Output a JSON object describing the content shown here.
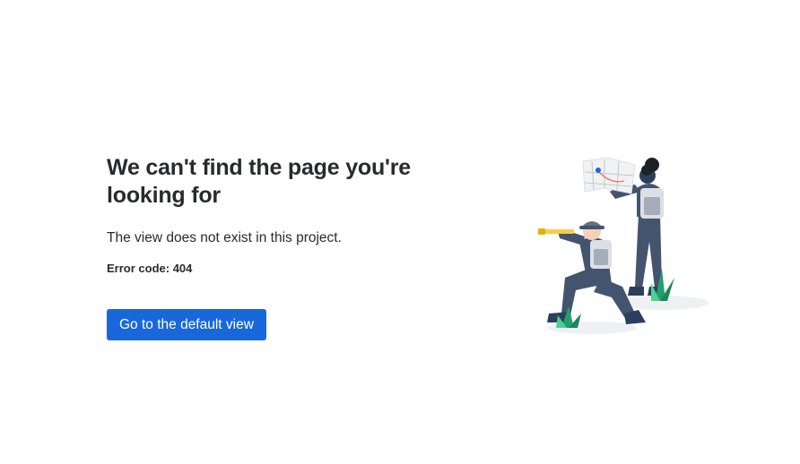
{
  "error_page": {
    "title": "We can't find the page you're looking for",
    "description": "The view does not exist in this project.",
    "error_code_label": "Error code:",
    "error_code_value": "404",
    "button_label": "Go to the default view"
  },
  "colors": {
    "primary_button": "#1868db",
    "text": "#292a2e",
    "figure_navy": "#44546f",
    "backpack": "#c1c7d0",
    "plant_green": "#22a06b",
    "telescope_yellow": "#f5cd47",
    "map_pin_blue": "#1868db"
  }
}
